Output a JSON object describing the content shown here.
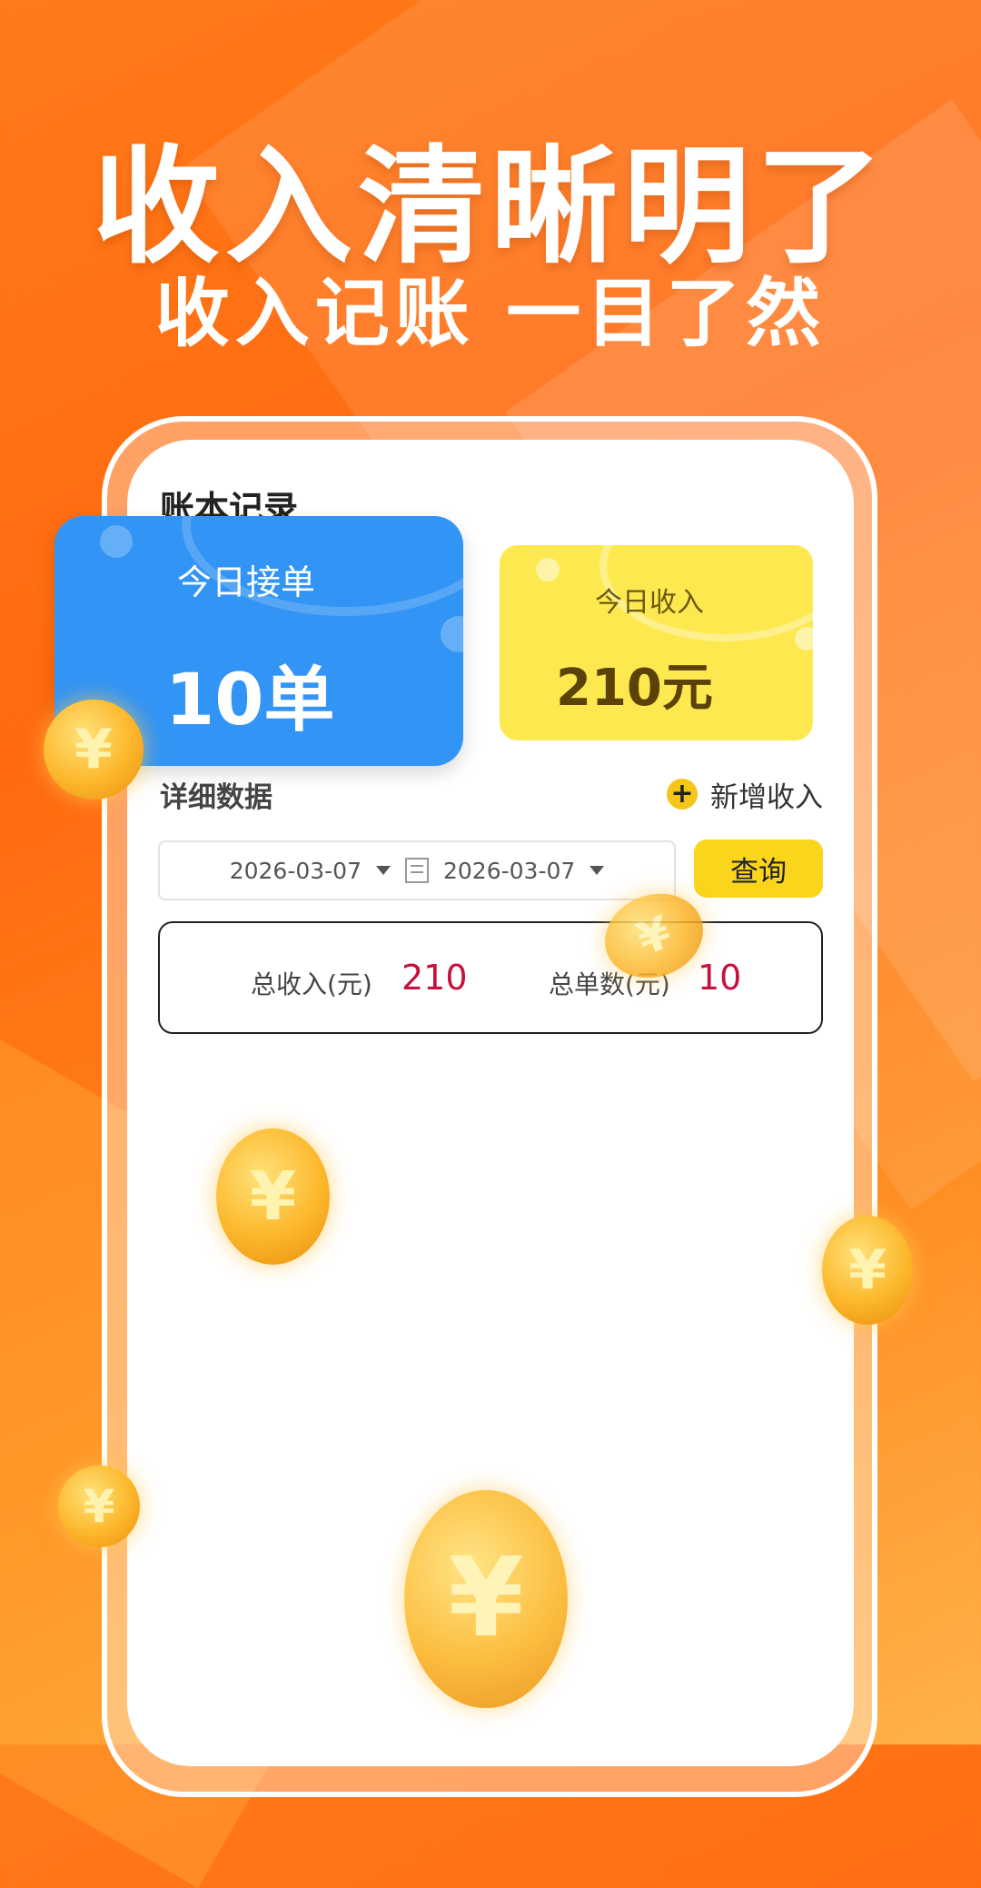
{
  "promo": {
    "headline": "收入清晰明了",
    "subline": "收入记账 一目了然"
  },
  "screen": {
    "title": "账本记录",
    "orders_card": {
      "label": "今日接单",
      "value": "10单"
    },
    "income_card": {
      "label": "今日收入",
      "value": "210元"
    },
    "details_label": "详细数据",
    "add_income_label": "新增收入",
    "date_from": "2026-03-07",
    "date_to": "2026-03-07",
    "query_label": "查询",
    "totals": {
      "income_label": "总收入(元)",
      "income_value": "210",
      "orders_label": "总单数(元)",
      "orders_value": "10"
    }
  },
  "coin_symbol": "¥",
  "colors": {
    "background": "#ff7a1a",
    "orders_card": "#3294f5",
    "income_card": "#fde94f",
    "query_button": "#f9d51c",
    "total_value": "#c4123c"
  }
}
